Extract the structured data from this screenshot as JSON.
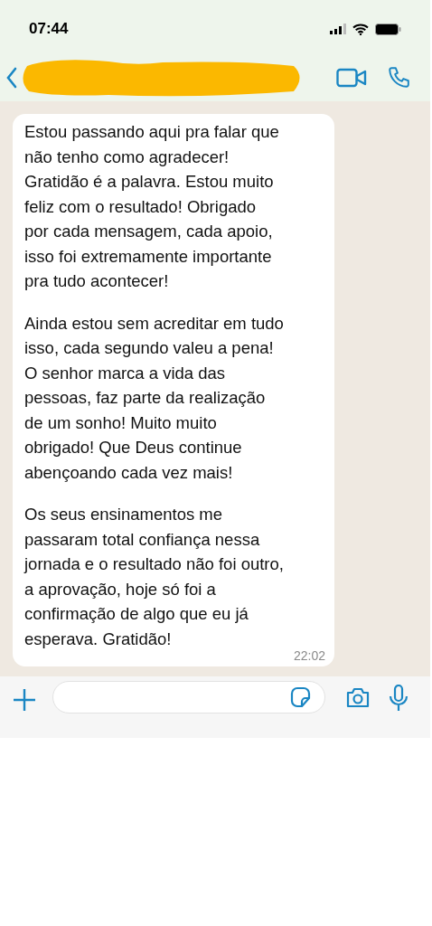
{
  "status_bar": {
    "time": "07:44"
  },
  "header": {
    "redacted": true
  },
  "message": {
    "paragraphs": [
      "Estou passando aqui pra falar que\nnão tenho como agradecer!\nGratidão é a palavra. Estou muito\nfeliz com o resultado! Obrigado\npor cada mensagem, cada apoio,\nisso foi extremamente importante\npra tudo acontecer!",
      "Ainda estou sem acreditar em tudo\nisso, cada segundo valeu a pena!\nO senhor marca a vida das\npessoas, faz  parte da realização\nde um sonho! Muito muito\nobrigado! Que Deus continue\nabençoando cada vez mais!",
      "Os seus ensinamentos me\npassaram total confiança nessa\njornada e o resultado não foi outro,\na aprovação, hoje só foi a\nconfirmação de algo que eu já\nesperava. Gratidão!"
    ],
    "time": "22:02"
  }
}
